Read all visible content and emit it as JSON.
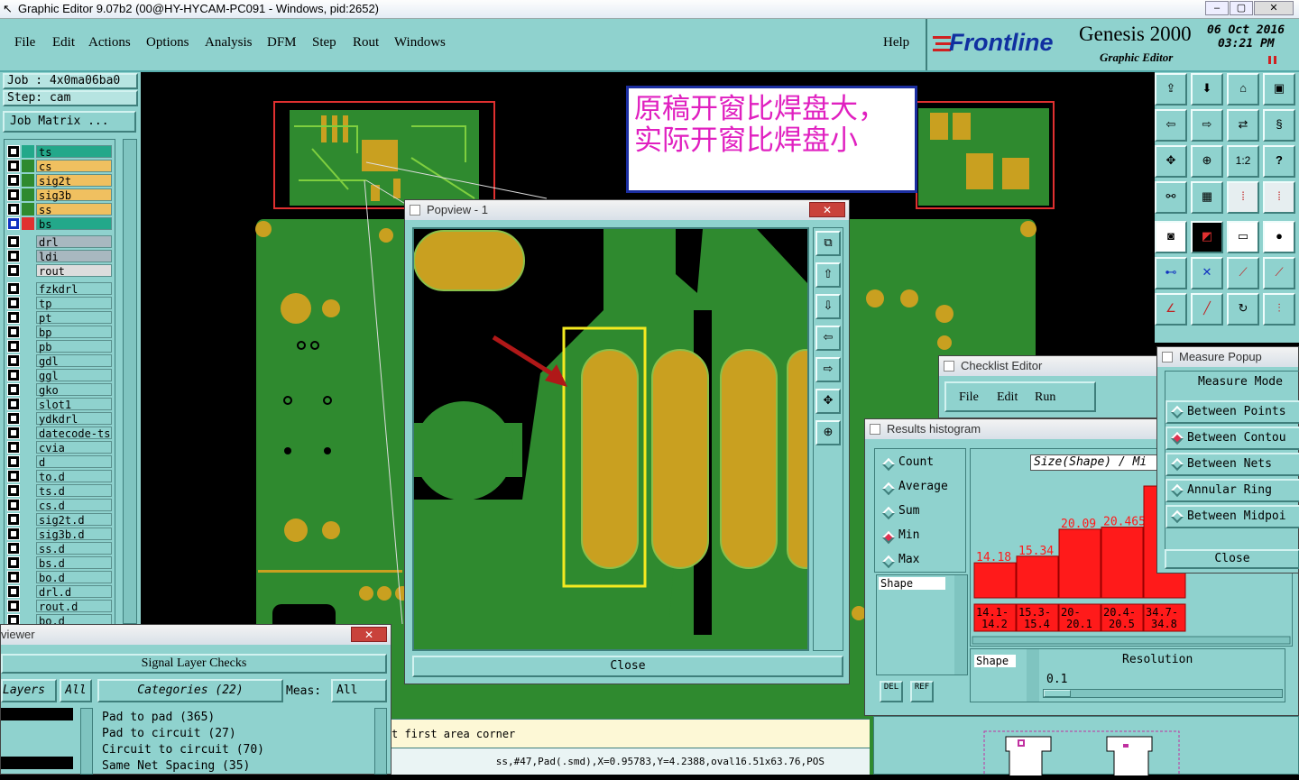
{
  "window": {
    "title": "Graphic Editor 9.07b2 (00@HY-HYCAM-PC091 - Windows, pid:2652)"
  },
  "menu": [
    "File",
    "Edit",
    "Actions",
    "Options",
    "Analysis",
    "DFM",
    "Step",
    "Rout",
    "Windows"
  ],
  "help": "Help",
  "brand": {
    "logo": "Frontline",
    "product": "Genesis 2000",
    "subtitle": "Graphic Editor",
    "date": "06 Oct 2016",
    "time": "03:21 PM"
  },
  "job": {
    "job_label": "Job : 4x0ma06ba0",
    "step_label": "Step: cam",
    "matrix_btn": "Job Matrix ..."
  },
  "layers": [
    {
      "name": "ts",
      "color": "#23a88a"
    },
    {
      "name": "cs",
      "color": "#f0c060"
    },
    {
      "name": "sig2t",
      "color": "#f0c060"
    },
    {
      "name": "sig3b",
      "color": "#f0c060"
    },
    {
      "name": "ss",
      "color": "#f0c060"
    },
    {
      "name": "bs",
      "color": "#23a88a"
    },
    {
      "name": "drl",
      "color": "#a8b8c0"
    },
    {
      "name": "ldi",
      "color": "#a8b8c0"
    },
    {
      "name": "rout",
      "color": "#dddddd"
    },
    {
      "name": "fzkdrl"
    },
    {
      "name": "tp"
    },
    {
      "name": "pt"
    },
    {
      "name": "bp"
    },
    {
      "name": "pb"
    },
    {
      "name": "gdl"
    },
    {
      "name": "ggl"
    },
    {
      "name": "gko"
    },
    {
      "name": "slot1"
    },
    {
      "name": "ydkdrl"
    },
    {
      "name": "datecode-ts"
    },
    {
      "name": "cvia"
    },
    {
      "name": "d"
    },
    {
      "name": "to.d"
    },
    {
      "name": "ts.d"
    },
    {
      "name": "cs.d"
    },
    {
      "name": "sig2t.d"
    },
    {
      "name": "sig3b.d"
    },
    {
      "name": "ss.d"
    },
    {
      "name": "bs.d"
    },
    {
      "name": "bo.d"
    },
    {
      "name": "drl.d"
    },
    {
      "name": "rout.d"
    },
    {
      "name": "bo.d"
    }
  ],
  "annotation": "原稿开窗比焊盘大，实际开窗比焊盘小",
  "popview": {
    "title": "Popview - 1",
    "close": "Close"
  },
  "checklist": {
    "title": "Checklist Editor",
    "menu": [
      "File",
      "Edit",
      "Run"
    ]
  },
  "histogram": {
    "title": "Results histogram",
    "options": [
      "Count",
      "Average",
      "Sum",
      "Min",
      "Max"
    ],
    "selected": "Min",
    "shape_label": "Shape",
    "header": "Size(Shape) / Mi",
    "shape_btn": "Shape",
    "resolution_label": "Resolution",
    "resolution_value": "0.1",
    "del": "DEL",
    "ref": "REF"
  },
  "chart_data": {
    "type": "bar",
    "title": "Size(Shape) / Mi",
    "categories": [
      "14.1-14.2",
      "15.3-15.4",
      "20-20.1",
      "20.4-20.5",
      "34.7-34.8"
    ],
    "values": [
      14.18,
      15.34,
      20.09,
      20.465,
      34.7
    ],
    "labels": [
      "14.18",
      "15.34",
      "20.09",
      "20.465",
      ""
    ]
  },
  "measure": {
    "title": "Measure Popup",
    "mode_label": "Measure Mode",
    "items": [
      "Between Points",
      "Between Contou",
      "Between Nets",
      "Annular Ring",
      "Between Midpoi"
    ],
    "selected": "Between Contou",
    "close": "Close"
  },
  "viewer": {
    "title": "viewer",
    "header": "Signal Layer Checks",
    "layers_label": "Layers",
    "all": "All",
    "categories": "Categories (22)",
    "meas": "Meas:",
    "meas_all": "All",
    "items": [
      "Pad to pad (365)",
      "Pad to circuit (27)",
      "Circuit to circuit (70)",
      "Same Net Spacing (35)"
    ]
  },
  "status": {
    "prompt": "t first area corner",
    "info": "ss,#47,Pad(.smd),X=0.95783,Y=4.2388,oval16.51x63.76,POS"
  }
}
